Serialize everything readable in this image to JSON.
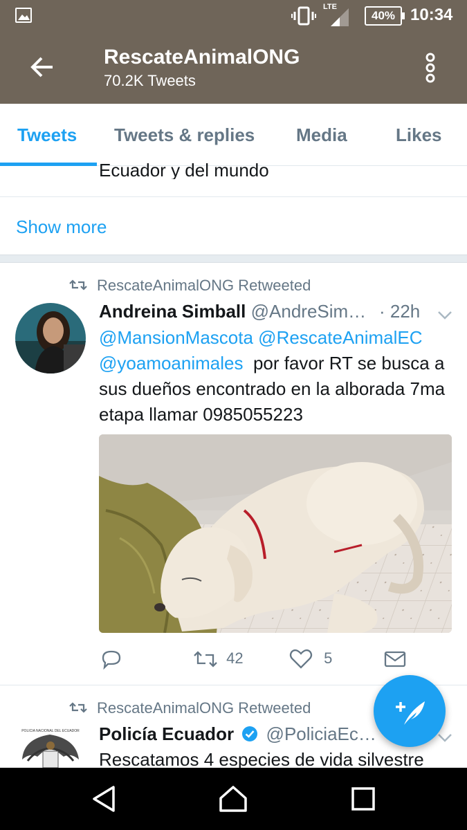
{
  "status_bar": {
    "network": "LTE",
    "battery": "40%",
    "time": "10:34"
  },
  "app_bar": {
    "title": "RescateAnimalONG",
    "subtitle": "70.2K Tweets"
  },
  "tabs": [
    {
      "label": "Tweets",
      "active": true
    },
    {
      "label": "Tweets & replies",
      "active": false
    },
    {
      "label": "Media",
      "active": false
    },
    {
      "label": "Likes",
      "active": false
    }
  ],
  "bio_fragment": "Ecuador y del mundo",
  "show_more": "Show more",
  "tweets": [
    {
      "retweet_label": "RescateAnimalONG Retweeted",
      "name": "Andreina Simball",
      "handle": "@AndreSim…",
      "time": "· 22h",
      "mentions": [
        "@MansionMascota",
        "@RescateAnimalEC",
        "@yoamoanimales"
      ],
      "text": "por favor RT se busca a sus dueños encontrado en la alborada 7ma etapa llamar 0985055223",
      "retweets": "42",
      "likes": "5"
    },
    {
      "retweet_label": "RescateAnimalONG Retweeted",
      "name": "Policía Ecuador",
      "handle": "@PoliciaEc…",
      "text": "Rescatamos 4 especies de vida silvestre"
    }
  ],
  "colors": {
    "header": "#6f6559",
    "accent": "#1da1f2",
    "muted": "#657786"
  },
  "icons": {
    "reply": "reply-icon",
    "retweet": "retweet-icon",
    "like": "heart-icon",
    "dm": "envelope-icon",
    "compose": "compose-tweet-icon"
  }
}
